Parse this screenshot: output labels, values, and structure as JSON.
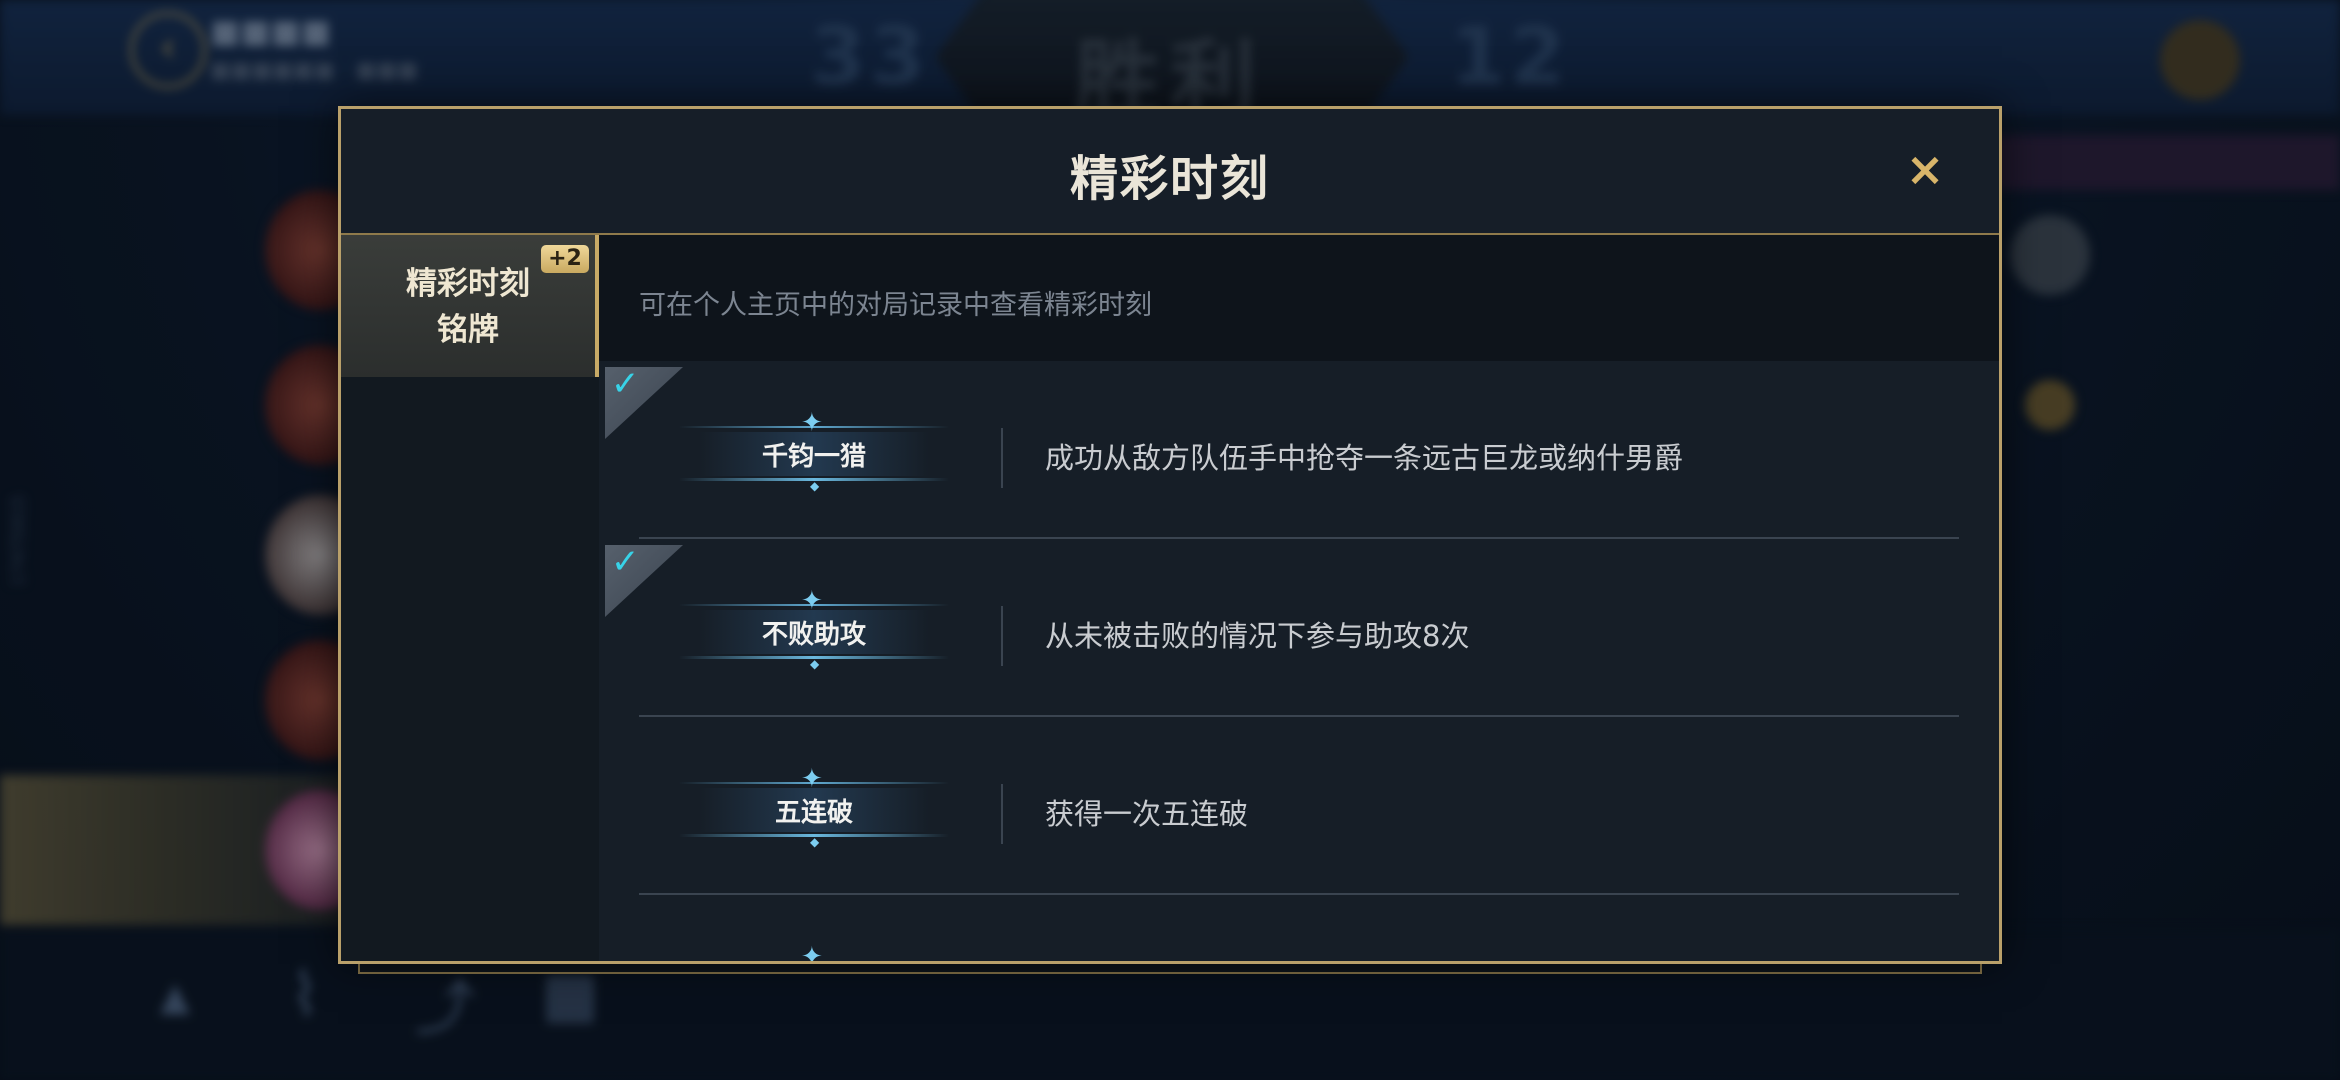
{
  "background": {
    "player_name": "■■■■",
    "player_sub": "■■■■■■ · ■■■",
    "score_left": "33",
    "score_right": "12",
    "result": "胜利",
    "side_id": "17475915"
  },
  "modal": {
    "title": "精彩时刻",
    "close_icon": "×",
    "sidebar": {
      "tabs": [
        {
          "label": "精彩时刻\n铭牌",
          "badge": "+2",
          "selected": true
        }
      ]
    },
    "info": "可在个人主页中的对局记录中查看精彩时刻",
    "achievements": [
      {
        "name": "千钧一猎",
        "description": "成功从敌方队伍手中抢夺一条远古巨龙或纳什男爵",
        "unlocked": true
      },
      {
        "name": "不败助攻",
        "description": "从未被击败的情况下参与助攻8次",
        "unlocked": true
      },
      {
        "name": "五连破",
        "description": "获得一次五连破",
        "unlocked": false
      }
    ]
  },
  "colors": {
    "gold": "#b9a06a",
    "check": "#38d3e8",
    "panel": "#141c25"
  }
}
